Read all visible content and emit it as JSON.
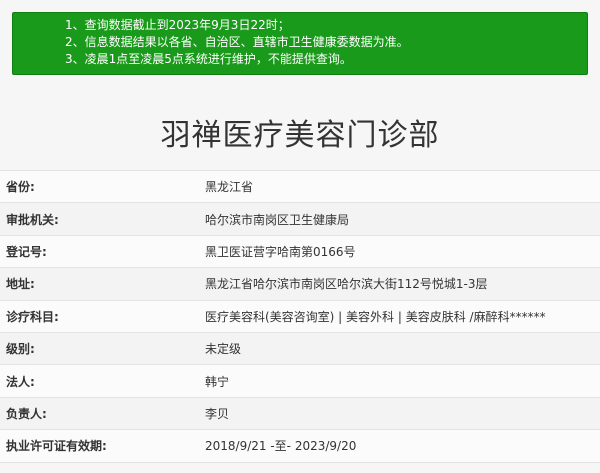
{
  "notice": {
    "lines": [
      "1、查询数据截止到2023年9月3日22时；",
      "2、信息数据结果以各省、自治区、直辖市卫生健康委数据为准。",
      "3、凌晨1点至凌晨5点系统进行维护，不能提供查询。"
    ]
  },
  "title": "羽禅医疗美容门诊部",
  "details": [
    {
      "label": "省份:",
      "value": "黑龙江省"
    },
    {
      "label": "审批机关:",
      "value": "哈尔滨市南岗区卫生健康局"
    },
    {
      "label": "登记号:",
      "value": "黑卫医证营字哈南第0166号"
    },
    {
      "label": "地址:",
      "value": "黑龙江省哈尔滨市南岗区哈尔滨大街112号悦城1-3层"
    },
    {
      "label": "诊疗科目:",
      "value": "医疗美容科(美容咨询室) | 美容外科 | 美容皮肤科 /麻醉科******"
    },
    {
      "label": "级别:",
      "value": "未定级"
    },
    {
      "label": "法人:",
      "value": "韩宁"
    },
    {
      "label": "负责人:",
      "value": "李贝"
    },
    {
      "label": "执业许可证有效期:",
      "value": "2018/9/21 -至- 2023/9/20"
    }
  ]
}
